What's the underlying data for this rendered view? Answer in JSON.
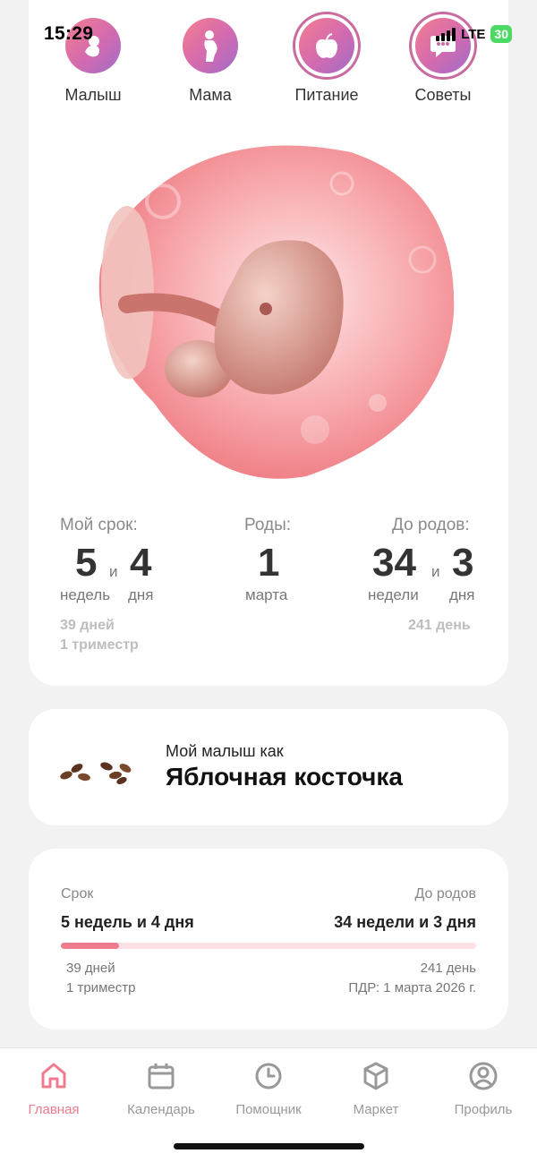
{
  "status_bar": {
    "time": "15:29",
    "network": "LTE",
    "battery": "30"
  },
  "tabs": [
    {
      "label": "Малыш",
      "icon": "baby-icon",
      "selected": false
    },
    {
      "label": "Мама",
      "icon": "pregnant-woman-icon",
      "selected": false
    },
    {
      "label": "Питание",
      "icon": "apple-icon",
      "selected": true
    },
    {
      "label": "Советы",
      "icon": "chat-bubble-icon",
      "selected": true
    }
  ],
  "term": {
    "my_term_label": "Мой срок:",
    "weeks": "5",
    "conj": "и",
    "days": "4",
    "weeks_unit": "недель",
    "days_unit": "дня",
    "birth_label": "Роды:",
    "birth_day": "1",
    "birth_month": "марта",
    "until_label": "До родов:",
    "until_weeks": "34",
    "until_conj": "и",
    "until_days": "3",
    "until_weeks_unit": "недели",
    "until_days_unit": "дня",
    "total_days": "39 дней",
    "trimester": "1 триместр",
    "days_left": "241 день"
  },
  "size_card": {
    "subtitle": "Мой малыш как",
    "title": "Яблочная косточка",
    "image": "apple-seeds-image"
  },
  "progress_card": {
    "term_label": "Срок",
    "term_value": "5 недель и 4 дня",
    "until_label": "До родов",
    "until_value": "34 недели и 3 дня",
    "progress_percent": 14,
    "days": "39 дней",
    "trimester": "1 триместр",
    "days_left": "241 день",
    "due_date": "ПДР: 1 марта 2026 г."
  },
  "nav": [
    {
      "label": "Главная",
      "icon": "home-icon",
      "active": true
    },
    {
      "label": "Календарь",
      "icon": "calendar-icon",
      "active": false
    },
    {
      "label": "Помощник",
      "icon": "clock-icon",
      "active": false
    },
    {
      "label": "Маркет",
      "icon": "box-icon",
      "active": false
    },
    {
      "label": "Профиль",
      "icon": "profile-icon",
      "active": false
    }
  ],
  "colors": {
    "accent": "#f07b8e",
    "tab_gradient_start": "#f47e8f",
    "tab_gradient_end": "#a06ec8",
    "muted": "#bdbdbd"
  }
}
